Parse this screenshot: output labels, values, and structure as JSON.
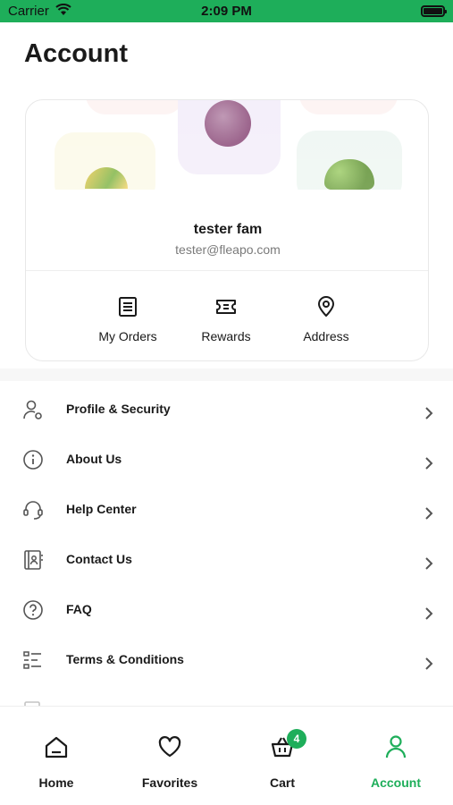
{
  "status_bar": {
    "carrier": "Carrier",
    "time": "2:09 PM"
  },
  "page": {
    "title": "Account"
  },
  "profile": {
    "name": "tester fam",
    "email": "tester@fleapo.com",
    "actions": [
      {
        "label": "My Orders",
        "icon": "orders-list-icon"
      },
      {
        "label": "Rewards",
        "icon": "ticket-icon"
      },
      {
        "label": "Address",
        "icon": "location-pin-icon"
      }
    ]
  },
  "menu": [
    {
      "label": "Profile & Security",
      "icon": "user-gear-icon"
    },
    {
      "label": "About Us",
      "icon": "info-icon"
    },
    {
      "label": "Help Center",
      "icon": "headset-icon"
    },
    {
      "label": "Contact Us",
      "icon": "contact-book-icon"
    },
    {
      "label": "FAQ",
      "icon": "question-icon"
    },
    {
      "label": "Terms & Conditions",
      "icon": "list-icon"
    }
  ],
  "tabs": [
    {
      "label": "Home",
      "icon": "home-icon"
    },
    {
      "label": "Favorites",
      "icon": "heart-icon"
    },
    {
      "label": "Cart",
      "icon": "basket-icon",
      "badge": "4"
    },
    {
      "label": "Account",
      "icon": "user-icon",
      "active": true
    }
  ],
  "colors": {
    "accent": "#1eae5a",
    "text": "#1a1a1a",
    "muted": "#7a7a7a"
  }
}
